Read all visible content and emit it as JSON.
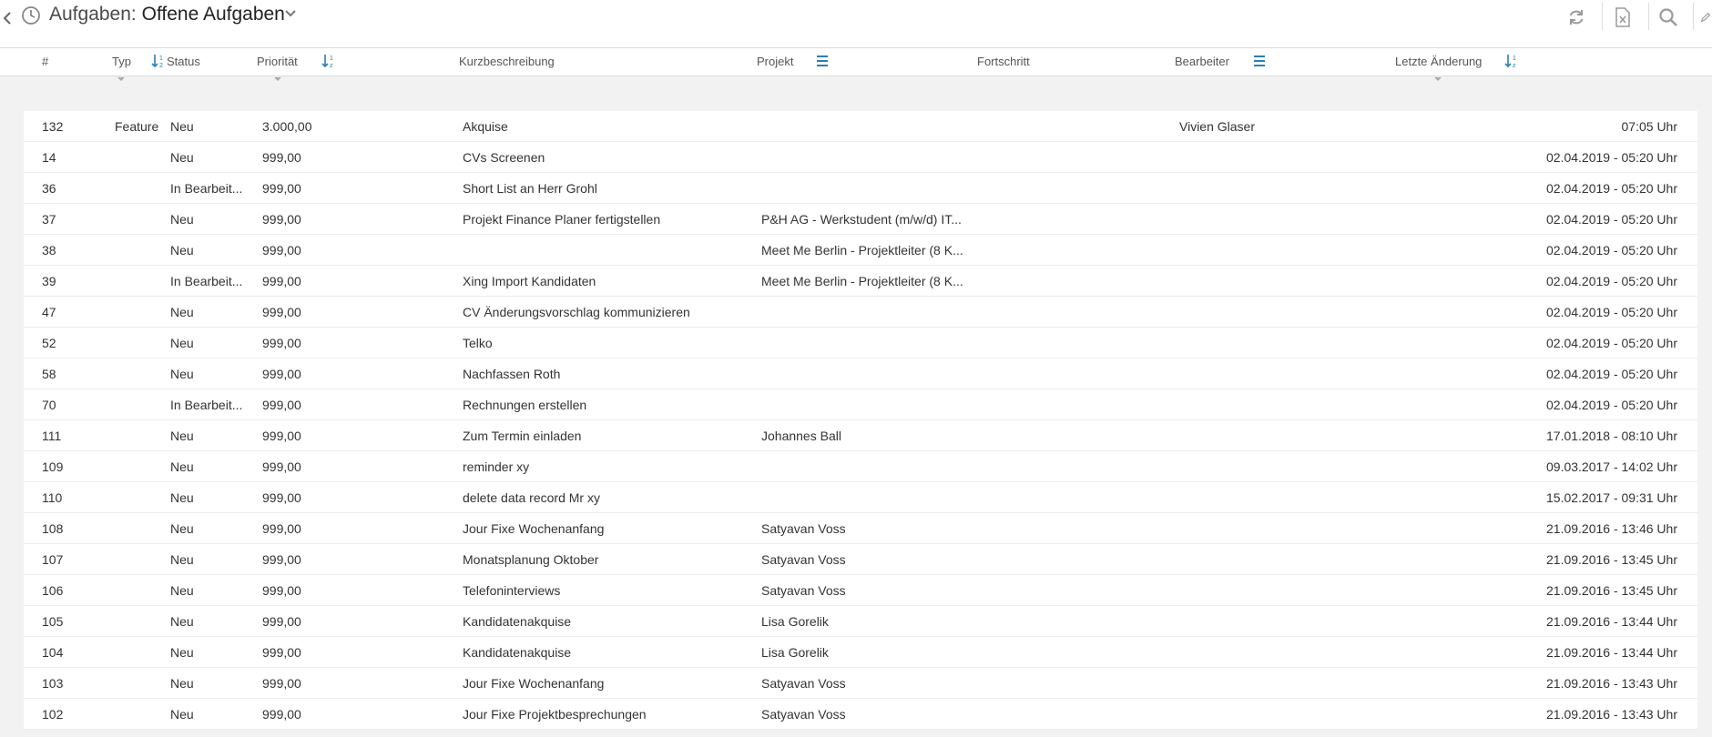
{
  "header": {
    "title_prefix": "Aufgaben:",
    "title_main": "Offene Aufgaben"
  },
  "toolbar": {
    "icons": [
      "refresh-icon",
      "excel-export-icon",
      "search-icon",
      "edit-icon"
    ]
  },
  "columns": {
    "id": "#",
    "type": "Typ",
    "status": "Status",
    "priority": "Priorität",
    "description": "Kurzbeschreibung",
    "project": "Projekt",
    "progress": "Fortschritt",
    "assignee": "Bearbeiter",
    "last_change": "Letzte Änderung"
  },
  "rows": [
    {
      "id": "132",
      "type": "Feature",
      "status": "Neu",
      "priority": "3.000,00",
      "description": "Akquise",
      "project": "",
      "assignee": "Vivien Glaser",
      "last_change": "07:05 Uhr"
    },
    {
      "id": "14",
      "type": "",
      "status": "Neu",
      "priority": "999,00",
      "description": "CVs Screenen",
      "project": "",
      "assignee": "",
      "last_change": "02.04.2019 - 05:20 Uhr"
    },
    {
      "id": "36",
      "type": "",
      "status": "In Bearbeit...",
      "priority": "999,00",
      "description": "Short List an Herr Grohl",
      "project": "",
      "assignee": "",
      "last_change": "02.04.2019 - 05:20 Uhr"
    },
    {
      "id": "37",
      "type": "",
      "status": "Neu",
      "priority": "999,00",
      "description": "Projekt Finance Planer fertigstellen",
      "project": "P&H AG - Werkstudent (m/w/d) IT...",
      "assignee": "",
      "last_change": "02.04.2019 - 05:20 Uhr"
    },
    {
      "id": "38",
      "type": "",
      "status": "Neu",
      "priority": "999,00",
      "description": "",
      "project": "Meet Me Berlin - Projektleiter (8 K...",
      "assignee": "",
      "last_change": "02.04.2019 - 05:20 Uhr"
    },
    {
      "id": "39",
      "type": "",
      "status": "In Bearbeit...",
      "priority": "999,00",
      "description": "Xing Import Kandidaten",
      "project": "Meet Me Berlin - Projektleiter (8 K...",
      "assignee": "",
      "last_change": "02.04.2019 - 05:20 Uhr"
    },
    {
      "id": "47",
      "type": "",
      "status": "Neu",
      "priority": "999,00",
      "description": "CV Änderungsvorschlag kommunizieren",
      "project": "",
      "assignee": "",
      "last_change": "02.04.2019 - 05:20 Uhr"
    },
    {
      "id": "52",
      "type": "",
      "status": "Neu",
      "priority": "999,00",
      "description": "Telko",
      "project": "",
      "assignee": "",
      "last_change": "02.04.2019 - 05:20 Uhr"
    },
    {
      "id": "58",
      "type": "",
      "status": "Neu",
      "priority": "999,00",
      "description": "Nachfassen Roth",
      "project": "",
      "assignee": "",
      "last_change": "02.04.2019 - 05:20 Uhr"
    },
    {
      "id": "70",
      "type": "",
      "status": "In Bearbeit...",
      "priority": "999,00",
      "description": "Rechnungen erstellen",
      "project": "",
      "assignee": "",
      "last_change": "02.04.2019 - 05:20 Uhr"
    },
    {
      "id": "111",
      "type": "",
      "status": "Neu",
      "priority": "999,00",
      "description": "Zum Termin einladen",
      "project": "Johannes Ball",
      "assignee": "",
      "last_change": "17.01.2018 - 08:10 Uhr"
    },
    {
      "id": "109",
      "type": "",
      "status": "Neu",
      "priority": "999,00",
      "description": "reminder xy",
      "project": "",
      "assignee": "",
      "last_change": "09.03.2017 - 14:02 Uhr"
    },
    {
      "id": "110",
      "type": "",
      "status": "Neu",
      "priority": "999,00",
      "description": "delete data record Mr xy",
      "project": "",
      "assignee": "",
      "last_change": "15.02.2017 - 09:31 Uhr"
    },
    {
      "id": "108",
      "type": "",
      "status": "Neu",
      "priority": "999,00",
      "description": "Jour Fixe Wochenanfang",
      "project": "Satyavan Voss",
      "assignee": "",
      "last_change": "21.09.2016 - 13:46 Uhr"
    },
    {
      "id": "107",
      "type": "",
      "status": "Neu",
      "priority": "999,00",
      "description": "Monatsplanung Oktober",
      "project": "Satyavan Voss",
      "assignee": "",
      "last_change": "21.09.2016 - 13:45 Uhr"
    },
    {
      "id": "106",
      "type": "",
      "status": "Neu",
      "priority": "999,00",
      "description": "Telefoninterviews",
      "project": "Satyavan Voss",
      "assignee": "",
      "last_change": "21.09.2016 - 13:45 Uhr"
    },
    {
      "id": "105",
      "type": "",
      "status": "Neu",
      "priority": "999,00",
      "description": "Kandidatenakquise",
      "project": "Lisa Gorelik",
      "assignee": "",
      "last_change": "21.09.2016 - 13:44 Uhr"
    },
    {
      "id": "104",
      "type": "",
      "status": "Neu",
      "priority": "999,00",
      "description": "Kandidatenakquise",
      "project": "Lisa Gorelik",
      "assignee": "",
      "last_change": "21.09.2016 - 13:44 Uhr"
    },
    {
      "id": "103",
      "type": "",
      "status": "Neu",
      "priority": "999,00",
      "description": "Jour Fixe Wochenanfang",
      "project": "Satyavan Voss",
      "assignee": "",
      "last_change": "21.09.2016 - 13:43 Uhr"
    },
    {
      "id": "102",
      "type": "",
      "status": "Neu",
      "priority": "999,00",
      "description": "Jour Fixe Projektbesprechungen",
      "project": "Satyavan Voss",
      "assignee": "",
      "last_change": "21.09.2016 - 13:43 Uhr"
    }
  ],
  "colors": {
    "accent_icon": "#2b7fb5",
    "icon_gray": "#9a9a9a"
  }
}
